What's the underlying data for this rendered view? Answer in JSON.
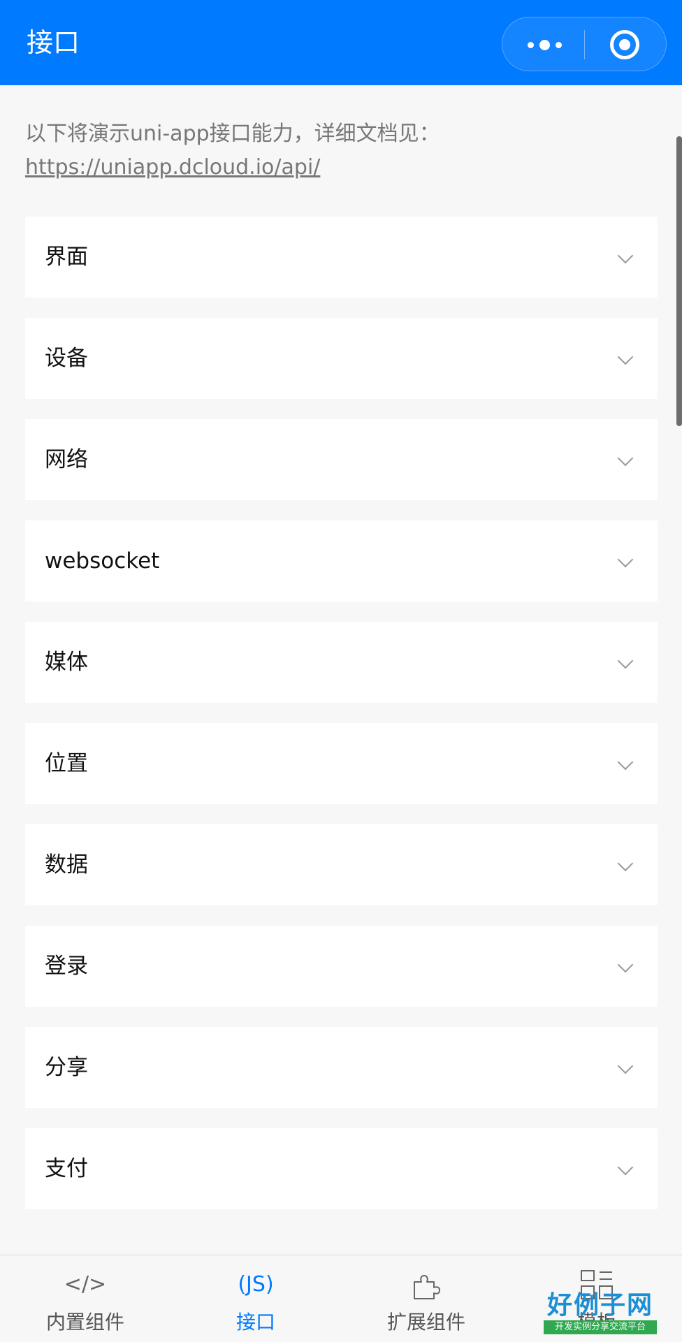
{
  "header": {
    "title": "接口",
    "background": "#007aff"
  },
  "intro": {
    "text": "以下将演示uni-app接口能力，详细文档见：",
    "link": "https://uniapp.dcloud.io/api/"
  },
  "list": {
    "items": [
      {
        "label": "界面",
        "icon": "chevron-down-icon"
      },
      {
        "label": "设备",
        "icon": "chevron-down-icon"
      },
      {
        "label": "网络",
        "icon": "chevron-down-icon"
      },
      {
        "label": "websocket",
        "icon": "chevron-down-icon"
      },
      {
        "label": "媒体",
        "icon": "chevron-down-icon"
      },
      {
        "label": "位置",
        "icon": "chevron-down-icon"
      },
      {
        "label": "数据",
        "icon": "chevron-down-icon"
      },
      {
        "label": "登录",
        "icon": "chevron-down-icon"
      },
      {
        "label": "分享",
        "icon": "chevron-down-icon"
      },
      {
        "label": "支付",
        "icon": "chevron-down-icon"
      }
    ]
  },
  "tabbar": {
    "tabs": [
      {
        "label": "内置组件",
        "icon_text": "</>",
        "icon": "code-icon",
        "active": false
      },
      {
        "label": "接口",
        "icon_text": "(JS)",
        "icon": "js-icon",
        "active": true
      },
      {
        "label": "扩展组件",
        "icon": "puzzle-icon",
        "active": false
      },
      {
        "label": "模板",
        "icon": "template-icon",
        "active": false
      }
    ],
    "active_color": "#007aff"
  },
  "watermark": {
    "logo_title": "好例子网",
    "logo_subtitle": "开发实例分享交流平台"
  }
}
